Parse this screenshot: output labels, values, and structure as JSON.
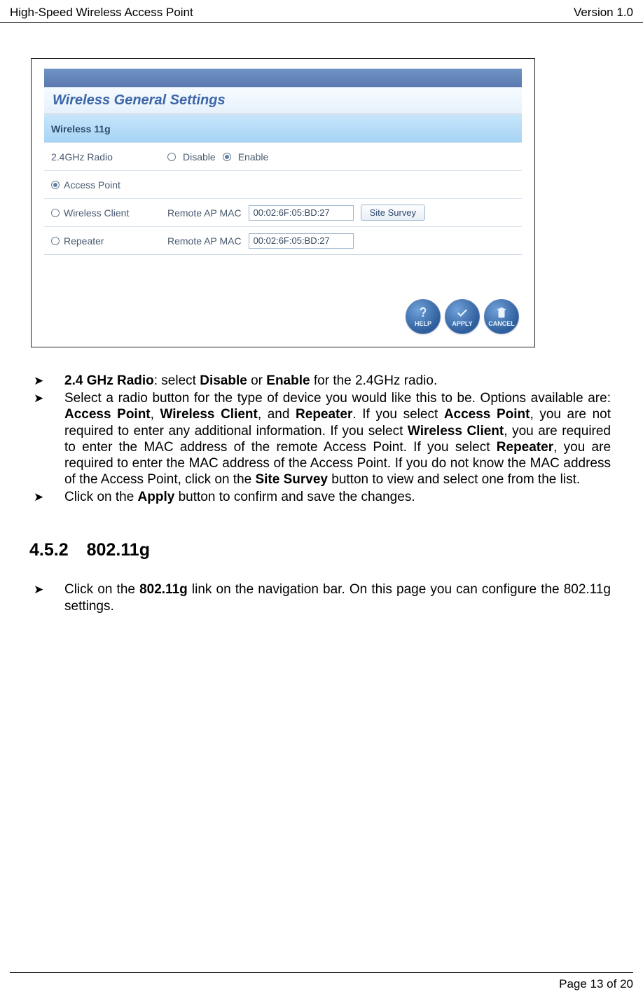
{
  "header": {
    "title": "High-Speed Wireless Access Point",
    "version": "Version 1.0"
  },
  "panel": {
    "heading": "Wireless General Settings",
    "subhead": "Wireless 11g",
    "radio_label": "2.4GHz Radio",
    "disable": "Disable",
    "enable": "Enable",
    "mode_ap": "Access Point",
    "mode_client": "Wireless Client",
    "mode_repeater": "Repeater",
    "remote_label": "Remote AP MAC",
    "mac1": "00:02:6F:05:BD:27",
    "mac2": "00:02:6F:05:BD:27",
    "site_survey": "Site Survey",
    "help": "HELP",
    "apply": "APPLY",
    "cancel": "CANCEL"
  },
  "bullets": {
    "b1_label": "2.4 GHz Radio",
    "b1_mid": ": select ",
    "b1_disable": "Disable",
    "b1_or": " or ",
    "b1_enable": "Enable",
    "b1_tail": " for the 2.4GHz radio.",
    "b2_a": "Select  a  radio  button  for  the  type  of  device  you  would  like  this  to  be.  Options available are: ",
    "b2_ap": "Access Point",
    "b2_c1": ", ",
    "b2_wc": "Wireless Client",
    "b2_c2": ", and ",
    "b2_rp": "Repeater",
    "b2_c3": ".  If you select ",
    "b2_ap2": "Access Point",
    "b2_c4": ",  you  are  not  required  to  enter  any  additional  information.    If  you  select ",
    "b2_wc2": "Wireless Client",
    "b2_c5": ", you are required to enter the MAC address of the remote Access Point.  If you select ",
    "b2_rp2": "Repeater",
    "b2_c6": ", you are required to enter the MAC address of the Access Point.  If you do not know the MAC address of the Access Point, click on the ",
    "b2_ss": "Site Survey",
    "b2_c7": " button to view and select one from the list.",
    "b3_a": "Click on the ",
    "b3_apply": "Apply",
    "b3_b": " button to confirm and save the changes."
  },
  "section": {
    "num": "4.5.2",
    "title": "802.11g"
  },
  "bullets2": {
    "a": "Click on the ",
    "link": "802.11g",
    "b": " link on the navigation bar.  On this page you can configure the 802.11g settings."
  },
  "footer": {
    "page": "Page 13 of 20"
  }
}
